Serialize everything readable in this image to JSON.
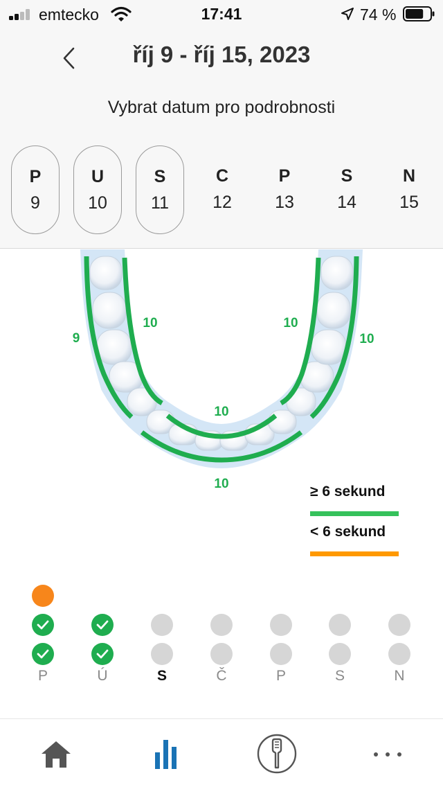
{
  "status_bar": {
    "carrier": "emtecko",
    "time": "17:41",
    "battery_percent": "74 %",
    "battery_level": 0.74
  },
  "header": {
    "title": "říj 9 - říj 15, 2023",
    "instruction": "Vybrat datum pro podrobnosti"
  },
  "days": [
    {
      "abbr": "P",
      "num": "9",
      "has_sessions": true
    },
    {
      "abbr": "U",
      "num": "10",
      "has_sessions": true
    },
    {
      "abbr": "S",
      "num": "11",
      "has_sessions": true
    },
    {
      "abbr": "C",
      "num": "12",
      "has_sessions": false
    },
    {
      "abbr": "P",
      "num": "13",
      "has_sessions": false
    },
    {
      "abbr": "S",
      "num": "14",
      "has_sessions": false
    },
    {
      "abbr": "N",
      "num": "15",
      "has_sessions": false
    }
  ],
  "zones": {
    "left_outer": "9",
    "left_inner": "10",
    "right_inner": "10",
    "right_outer": "10",
    "front_inner": "10",
    "front_outer": "10"
  },
  "colors": {
    "good": "#1fad4f",
    "warning": "#f7861b",
    "legend_good": "#35c15b",
    "legend_warning": "#ff9900",
    "inactive_dot": "#d6d6d6",
    "accent_blue": "#1a73b5"
  },
  "legend": {
    "good_label": "≥ 6 sekund",
    "warning_label": "< 6 sekund"
  },
  "history": {
    "weekdays": [
      "P",
      "Ú",
      "S",
      "Č",
      "P",
      "S",
      "N"
    ],
    "active_index": 2,
    "columns": [
      [
        "orange",
        "green",
        "green"
      ],
      [
        "green",
        "green"
      ],
      [
        "grey",
        "grey"
      ],
      [
        "grey",
        "grey"
      ],
      [
        "grey",
        "grey"
      ],
      [
        "grey",
        "grey"
      ],
      [
        "grey",
        "grey"
      ]
    ]
  },
  "tabs": [
    {
      "icon": "home-icon",
      "active": false
    },
    {
      "icon": "bar-chart-icon",
      "active": true
    },
    {
      "icon": "brush-head-icon",
      "active": false
    },
    {
      "icon": "more-icon",
      "active": false
    }
  ]
}
